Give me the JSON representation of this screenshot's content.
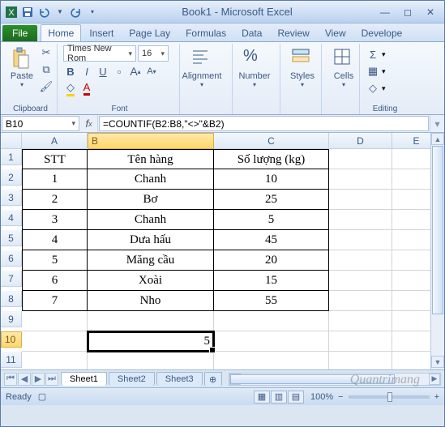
{
  "window": {
    "title": "Book1 - Microsoft Excel"
  },
  "qat": {
    "save": "save-icon",
    "undo": "undo-icon",
    "redo": "redo-icon"
  },
  "tabs": {
    "file": "File",
    "items": [
      "Home",
      "Insert",
      "Page Lay",
      "Formulas",
      "Data",
      "Review",
      "View",
      "Develope"
    ],
    "active": 0
  },
  "ribbon": {
    "clipboard": {
      "label": "Clipboard",
      "paste": "Paste"
    },
    "font": {
      "label": "Font",
      "name": "Times New Rom",
      "size": "16",
      "bold": "B",
      "italic": "I",
      "underline": "U",
      "grow": "A",
      "shrink": "A"
    },
    "alignment": {
      "label": "Alignment",
      "btn": "Alignment"
    },
    "number": {
      "label": "Number",
      "btn": "Number"
    },
    "styles": {
      "label": "Styles",
      "btn": "Styles"
    },
    "cells": {
      "label": "Cells",
      "btn": "Cells"
    },
    "editing": {
      "label": "Editing"
    }
  },
  "namebox": "B10",
  "formula": "=COUNTIF(B2:B8,\"<>\"&B2)",
  "active_result": "5",
  "columns": [
    "A",
    "B",
    "C",
    "D",
    "E"
  ],
  "rows": [
    "1",
    "2",
    "3",
    "4",
    "5",
    "6",
    "7",
    "8",
    "9",
    "10",
    "11"
  ],
  "table": {
    "headers": {
      "a": "STT",
      "b": "Tên hàng",
      "c": "Số lượng (kg)"
    },
    "rows": [
      {
        "a": "1",
        "b": "Chanh",
        "c": "10"
      },
      {
        "a": "2",
        "b": "Bơ",
        "c": "25"
      },
      {
        "a": "3",
        "b": "Chanh",
        "c": "5"
      },
      {
        "a": "4",
        "b": "Dưa hấu",
        "c": "45"
      },
      {
        "a": "5",
        "b": "Măng cầu",
        "c": "20"
      },
      {
        "a": "6",
        "b": "Xoài",
        "c": "15"
      },
      {
        "a": "7",
        "b": "Nho",
        "c": "55"
      }
    ]
  },
  "sheets": {
    "items": [
      "Sheet1",
      "Sheet2",
      "Sheet3"
    ],
    "active": 0
  },
  "status": {
    "ready": "Ready",
    "zoom": "100%"
  },
  "watermark": "Quantrimang"
}
